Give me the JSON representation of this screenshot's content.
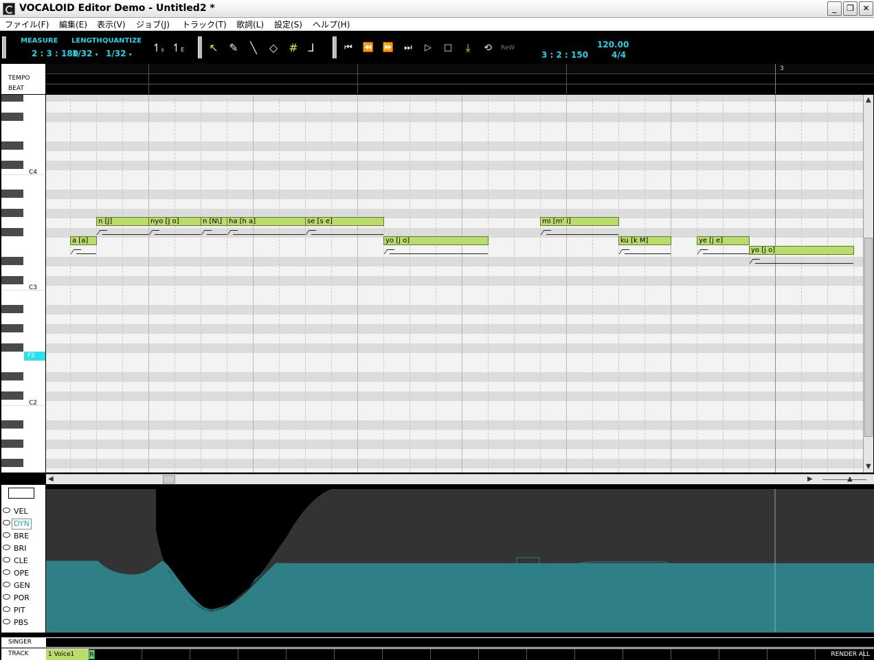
{
  "window": {
    "title": "VOCALOID Editor Demo - Untitled2 *"
  },
  "menu": [
    "ファイル(F)",
    "編集(E)",
    "表示(V)",
    "ジョブ(J)",
    "トラック(T)",
    "歌詞(L)",
    "設定(S)",
    "ヘルプ(H)"
  ],
  "toolbar": {
    "measure_label": "MEASURE",
    "length_label": "LENGTH",
    "quantize_label": "QUANTIZE",
    "measure_value": "2 : 3 : 180",
    "length_value": "1/32",
    "quantize_value": "1/32",
    "position": "3 : 2 : 150",
    "tempo": "120.00",
    "signature": "4/4",
    "tools": [
      "pointer-tool",
      "pencil-tool",
      "line-tool",
      "eraser-tool",
      "grid-tool",
      "curve-tool"
    ],
    "transport": [
      "start",
      "rewind",
      "forward",
      "end",
      "play",
      "stop",
      "follow",
      "loop",
      "rewire"
    ]
  },
  "ruler": {
    "tempo_label": "TEMPO",
    "beat_label": "BEAT",
    "measure_3": "3"
  },
  "piano": {
    "c4": "C4",
    "c3": "C3",
    "f2": "F2",
    "c2": "C2"
  },
  "notes": [
    {
      "lyric": "a [a]"
    },
    {
      "lyric": "n [J]"
    },
    {
      "lyric": "nyo [J o]"
    },
    {
      "lyric": "n [N\\]"
    },
    {
      "lyric": "ha [h a]"
    },
    {
      "lyric": "se [s e]"
    },
    {
      "lyric": "yo [j o]"
    },
    {
      "lyric": "mi [m' i]"
    },
    {
      "lyric": "ku [k M]"
    },
    {
      "lyric": "ye [j e]"
    },
    {
      "lyric": "yo [j o]"
    }
  ],
  "controls": [
    "VEL",
    "DYN",
    "BRE",
    "BRI",
    "CLE",
    "OPE",
    "GEN",
    "POR",
    "PIT",
    "PBS"
  ],
  "active_control": "DYN",
  "bottom": {
    "singer_label": "SINGER",
    "track_label": "TRACK",
    "track_name": "1 Voice1",
    "track_r": "R",
    "render_all": "RENDER ALL"
  }
}
